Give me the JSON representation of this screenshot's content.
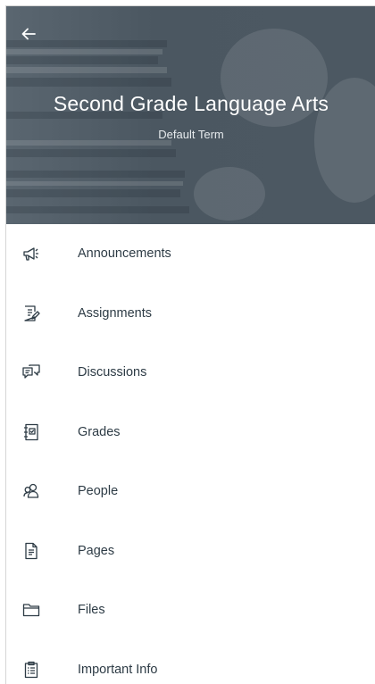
{
  "header": {
    "course_title": "Second Grade Language Arts",
    "term": "Default Term"
  },
  "menu": {
    "items": [
      {
        "label": "Announcements",
        "icon": "megaphone-icon"
      },
      {
        "label": "Assignments",
        "icon": "assignment-icon"
      },
      {
        "label": "Discussions",
        "icon": "discussion-icon"
      },
      {
        "label": "Grades",
        "icon": "gradebook-icon"
      },
      {
        "label": "People",
        "icon": "people-icon"
      },
      {
        "label": "Pages",
        "icon": "document-icon"
      },
      {
        "label": "Files",
        "icon": "folder-icon"
      },
      {
        "label": "Important Info",
        "icon": "clipboard-icon"
      }
    ]
  },
  "colors": {
    "header_overlay": "#4b5761",
    "text": "#2d3b45",
    "icon": "#2d3b45",
    "background": "#ffffff"
  }
}
